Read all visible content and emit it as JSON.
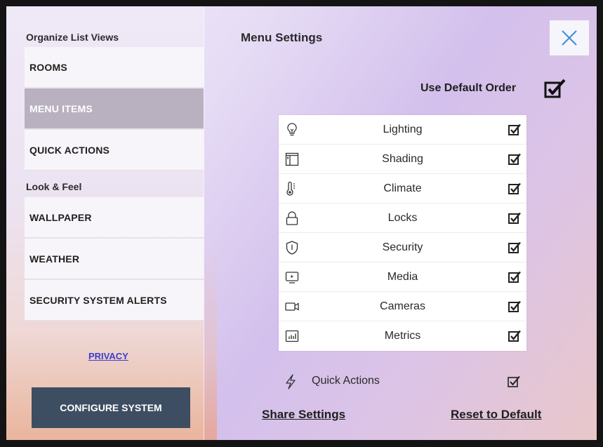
{
  "sidebar": {
    "organize_label": "Organize List Views",
    "organize_items": [
      {
        "label": "ROOMS",
        "active": false
      },
      {
        "label": "MENU ITEMS",
        "active": true
      },
      {
        "label": "QUICK ACTIONS",
        "active": false
      }
    ],
    "look_feel_label": "Look & Feel",
    "look_feel_items": [
      {
        "label": "WALLPAPER"
      },
      {
        "label": "WEATHER"
      },
      {
        "label": "SECURITY SYSTEM ALERTS"
      }
    ],
    "privacy_link": "PRIVACY",
    "configure_button": "CONFIGURE SYSTEM"
  },
  "main": {
    "title": "Menu Settings",
    "close_icon": "close-icon",
    "use_default_order_label": "Use Default Order",
    "use_default_order_checked": true,
    "menu_items": [
      {
        "label": "Lighting",
        "icon": "lightbulb-icon",
        "checked": true
      },
      {
        "label": "Shading",
        "icon": "shade-icon",
        "checked": true
      },
      {
        "label": "Climate",
        "icon": "thermometer-icon",
        "checked": true
      },
      {
        "label": "Locks",
        "icon": "lock-icon",
        "checked": true
      },
      {
        "label": "Security",
        "icon": "shield-icon",
        "checked": true
      },
      {
        "label": "Media",
        "icon": "media-icon",
        "checked": true
      },
      {
        "label": "Cameras",
        "icon": "camera-icon",
        "checked": true
      },
      {
        "label": "Metrics",
        "icon": "metrics-icon",
        "checked": true
      }
    ],
    "quick_actions": {
      "label": "Quick Actions",
      "icon": "lightning-icon",
      "checked": true
    },
    "share_settings": "Share Settings",
    "reset_to_default": "Reset to Default"
  },
  "colors": {
    "active_nav_bg": "#bab1c0",
    "configure_button_bg": "#3e4e62",
    "privacy_link": "#3a3ecf",
    "close_icon": "#3d8fd6"
  }
}
